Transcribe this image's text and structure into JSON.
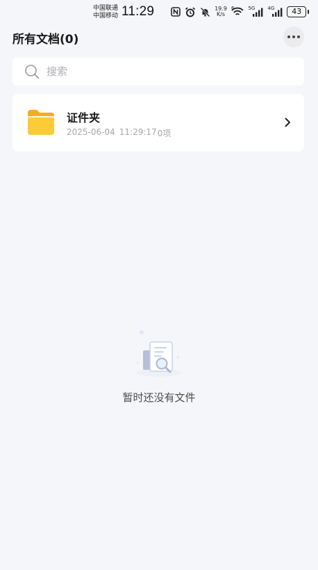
{
  "status_bar": {
    "carrier_1": "中国联通",
    "carrier_2": "中国移动",
    "time": "11:29",
    "net_speed_value": "19.9",
    "net_speed_unit": "K/s",
    "wifi_label": "6",
    "signal_1_label": "5G",
    "signal_2_label": "4G",
    "battery": "43"
  },
  "header": {
    "title": "所有文档(0)"
  },
  "search": {
    "placeholder": "搜索"
  },
  "folders": [
    {
      "name": "证件夹",
      "date": "2025-06-04",
      "time": "11:29:17",
      "count": "0项"
    }
  ],
  "empty_state": {
    "message": "暂时还没有文件"
  },
  "colors": {
    "background": "#f5f6f9",
    "card": "#ffffff",
    "folder_yellow": "#fccb36",
    "folder_back": "#f6ac20",
    "muted_text": "#a7a7ab"
  }
}
